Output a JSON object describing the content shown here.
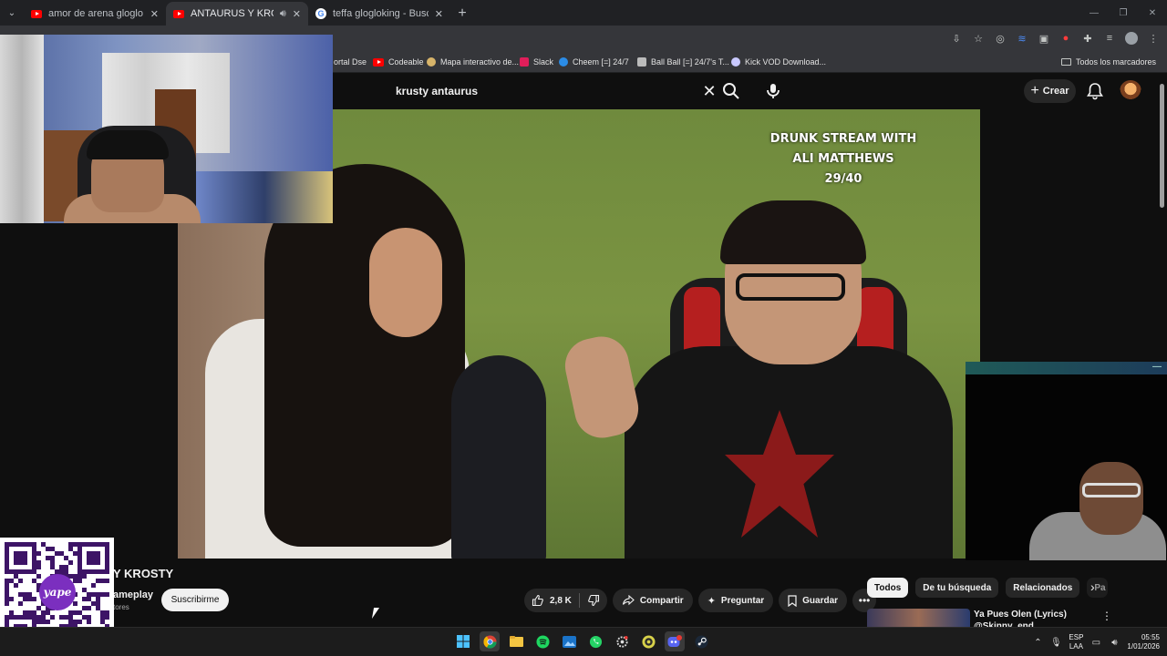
{
  "browser": {
    "tabs": [
      {
        "title": "amor de arena gloglo - YouTub",
        "favicon": "youtube-icon",
        "active": false
      },
      {
        "title": "ANTAURUS Y KROSTY - You",
        "favicon": "youtube-icon",
        "active": true,
        "audio": true
      },
      {
        "title": "teffa glogloking - Buscar con G",
        "favicon": "google-icon",
        "active": false
      }
    ],
    "bookmarks": [
      "ortal Dse",
      "Codeable",
      "Mapa interactivo de...",
      "Slack",
      "Cheem [=] 24/7",
      "Ball Ball [=] 24/7's T...",
      "Kick VOD Download..."
    ],
    "all_bookmarks": "Todos los marcadores"
  },
  "youtube": {
    "search_query": "krusty antaurus",
    "create_label": "Crear",
    "overlay_text": [
      "DRUNK STREAM WITH",
      "ALI MATTHEWS",
      "29/40"
    ],
    "video_title": "Y KROSTY",
    "channel_name": "ameplay",
    "subscribers": "tores",
    "subscribe_label": "Suscribirme",
    "likes": "2,8 K",
    "share_label": "Compartir",
    "ask_label": "Preguntar",
    "save_label": "Guardar",
    "chips": [
      "Todos",
      "De tu búsqueda",
      "Relacionados",
      "Pa"
    ],
    "recommendation": {
      "title": "Ya Pues Olen (Lyrics)",
      "channel": "@Skinny_end"
    }
  },
  "taskbar": {
    "lang_line1": "ESP",
    "lang_line2": "LAA",
    "time": "05:55",
    "date": "1/01/2026"
  },
  "qr": {
    "logo_text": "yape"
  },
  "colors": {
    "youtube_red": "#ff0000",
    "bg": "#0f0f0f",
    "chip_bg": "#272727"
  }
}
